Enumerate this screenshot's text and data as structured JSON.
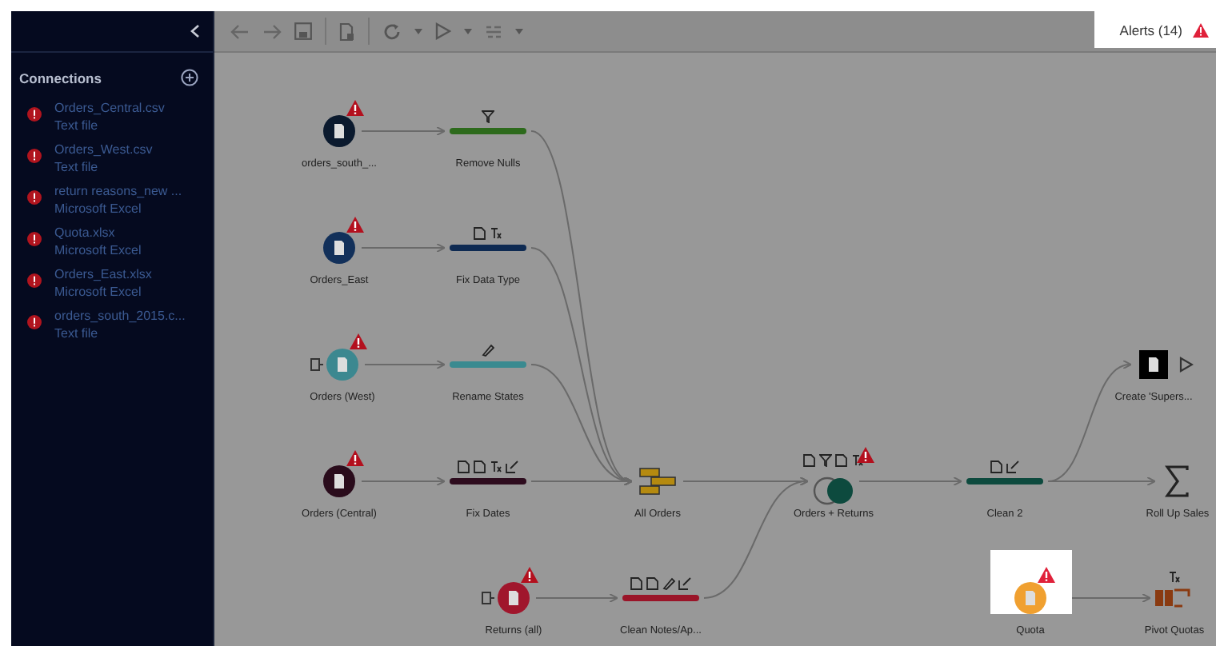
{
  "sidebar": {
    "title": "Connections",
    "connections": [
      {
        "name": "Orders_Central.csv",
        "type": "Text file",
        "error": true
      },
      {
        "name": "Orders_West.csv",
        "type": "Text file",
        "error": true
      },
      {
        "name": "return reasons_new ...",
        "type": "Microsoft Excel",
        "error": true
      },
      {
        "name": "Quota.xlsx",
        "type": "Microsoft Excel",
        "error": true
      },
      {
        "name": "Orders_East.xlsx",
        "type": "Microsoft Excel",
        "error": true
      },
      {
        "name": "orders_south_2015.c...",
        "type": "Text file",
        "error": true
      }
    ]
  },
  "alerts": {
    "label": "Alerts (14)"
  },
  "flow": {
    "nodes": [
      {
        "kind": "input",
        "label": "orders_south_...",
        "color": "#0b1a2e",
        "warning": true
      },
      {
        "kind": "clean",
        "label": "Remove Nulls",
        "color": "#2d6a1c"
      },
      {
        "kind": "input",
        "label": "Orders_East",
        "color": "#12305a",
        "warning": true
      },
      {
        "kind": "clean",
        "label": "Fix Data Type",
        "color": "#0e2a52"
      },
      {
        "kind": "input",
        "label": "Orders (West)",
        "color": "#3c8890",
        "warning": true
      },
      {
        "kind": "clean",
        "label": "Rename States",
        "color": "#3a8a90"
      },
      {
        "kind": "input",
        "label": "Orders (Central)",
        "color": "#2a0c1c",
        "warning": true
      },
      {
        "kind": "clean",
        "label": "Fix Dates",
        "color": "#2e0c1e"
      },
      {
        "kind": "union",
        "label": "All Orders",
        "color": "#b58a10"
      },
      {
        "kind": "input",
        "label": "Returns (all)",
        "color": "#a0162c",
        "warning": true
      },
      {
        "kind": "clean",
        "label": "Clean Notes/Ap...",
        "color": "#9a1428"
      },
      {
        "kind": "join",
        "label": "Orders + Returns",
        "color": "#0d4a3e",
        "warning": true
      },
      {
        "kind": "clean",
        "label": "Clean 2",
        "color": "#0d4a3e"
      },
      {
        "kind": "output",
        "label": "Create 'Supers...",
        "color": "#000000"
      },
      {
        "kind": "aggregate",
        "label": "Roll Up Sales",
        "color": "#222222"
      },
      {
        "kind": "input",
        "label": "Quota",
        "color": "#f0a030",
        "warning": true,
        "highlighted": true
      },
      {
        "kind": "pivot",
        "label": "Pivot Quotas",
        "color": "#8a3a10"
      }
    ]
  }
}
